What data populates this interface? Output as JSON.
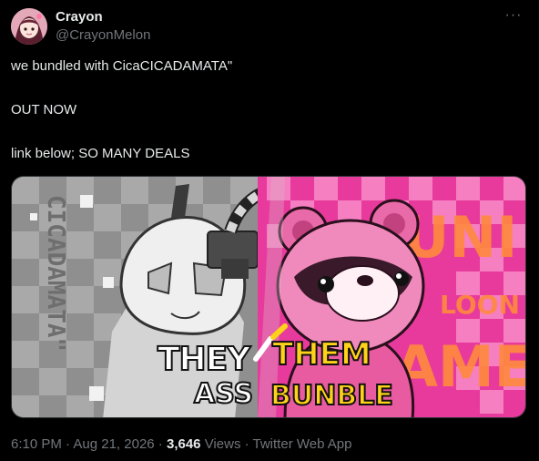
{
  "author": {
    "display_name": "Crayon",
    "handle": "@CrayonMelon"
  },
  "more_icon": "more-horizontal-icon",
  "tweet": {
    "lines": [
      "we bundled with CicaCICADAMATA\"",
      "OUT NOW",
      "link below; SO MANY DEALS"
    ]
  },
  "media": {
    "side_title_left": "CICADAMATA\"",
    "logo_they": "THEY",
    "logo_them": "THEM",
    "logo_ass": "ASS",
    "logo_bunble": "BUNBLE",
    "right_word_1": "UNI",
    "right_word_2": "LOON",
    "right_word_3": "AME",
    "colors": {
      "left_bg": "#8f8f8f",
      "right_bg": "#e83a9c",
      "logo_white": "#ffffff",
      "logo_yellow": "#ffd21a",
      "orange_text": "#ff8a3d"
    }
  },
  "meta": {
    "time": "6:10 PM",
    "date": "Aug 21, 2026",
    "sep": " · ",
    "views_count": "3,646",
    "views_label": "Views",
    "client": "Twitter Web App"
  }
}
